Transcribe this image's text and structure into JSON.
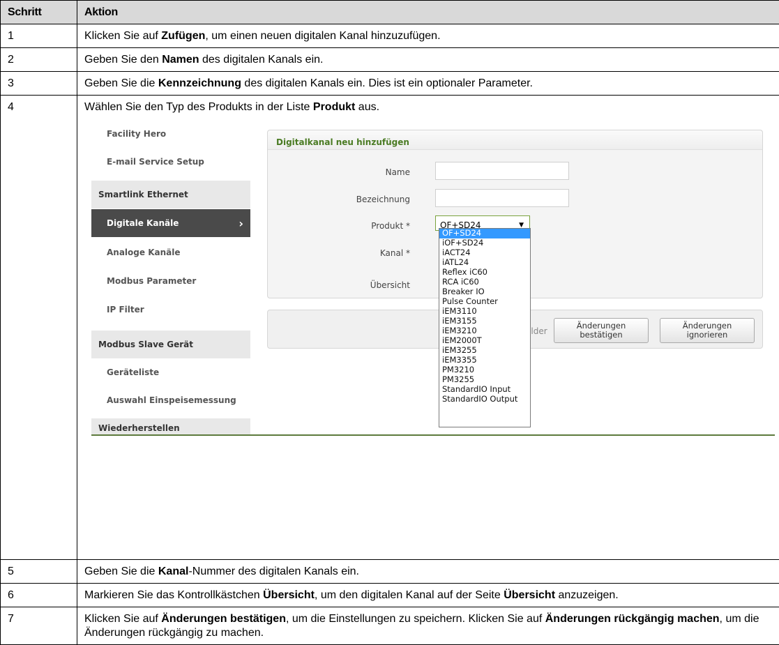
{
  "header": {
    "col_step": "Schritt",
    "col_action": "Aktion"
  },
  "rows": [
    {
      "step": "1",
      "parts": [
        "Klicken Sie auf ",
        "Zufügen",
        ", um einen neuen digitalen Kanal hinzuzufügen."
      ]
    },
    {
      "step": "2",
      "parts": [
        "Geben Sie den ",
        "Namen",
        " des digitalen Kanals ein."
      ]
    },
    {
      "step": "3",
      "parts": [
        "Geben Sie die ",
        "Kennzeichnung",
        " des digitalen Kanals ein. Dies ist ein optionaler Parameter."
      ]
    },
    {
      "step": "4",
      "parts": [
        "Wählen Sie den Typ des Produkts in der Liste ",
        "Produkt",
        " aus."
      ]
    },
    {
      "step": "5",
      "parts": [
        "Geben Sie die ",
        "Kanal",
        "-Nummer des digitalen Kanals ein."
      ]
    },
    {
      "step": "6",
      "parts": [
        "Markieren Sie das Kontrollkästchen ",
        "Übersicht",
        ", um den digitalen Kanal auf der Seite ",
        "Übersicht",
        " anzuzeigen."
      ]
    },
    {
      "step": "7",
      "parts": [
        "Klicken Sie auf ",
        "Änderungen bestätigen",
        ", um die Einstellungen zu speichern. Klicken Sie auf ",
        "Änderungen rückgängig machen",
        ", um die Änderungen rückgängig zu machen."
      ]
    }
  ],
  "screenshot": {
    "sidebar": [
      {
        "label": "Facility Hero",
        "kind": "sub"
      },
      {
        "label": "E-mail Service Setup",
        "kind": "sub"
      },
      {
        "label": "Smartlink Ethernet",
        "kind": "section"
      },
      {
        "label": "Digitale Kanäle",
        "kind": "active"
      },
      {
        "label": "Analoge Kanäle",
        "kind": "sub"
      },
      {
        "label": "Modbus Parameter",
        "kind": "sub"
      },
      {
        "label": "IP Filter",
        "kind": "sub"
      },
      {
        "label": "Modbus Slave Gerät",
        "kind": "section"
      },
      {
        "label": "Geräteliste",
        "kind": "sub"
      },
      {
        "label": "Auswahl Einspeisemessung",
        "kind": "sub"
      },
      {
        "label": "Wiederherstellen",
        "kind": "section"
      }
    ],
    "panel_title": "Digitalkanal neu hinzufügen",
    "form": {
      "name_label": "Name",
      "bezeichnung_label": "Bezeichnung",
      "produkt_label": "Produkt *",
      "produkt_value": "OF+SD24",
      "kanal_label": "Kanal *",
      "uebersicht_label": "Übersicht"
    },
    "dropdown_options": [
      "OF+SD24",
      "iOF+SD24",
      "iACT24",
      "iATL24",
      "Reflex iC60",
      "RCA iC60",
      "Breaker IO",
      "Pulse Counter",
      "iEM3110",
      "iEM3155",
      "iEM3210",
      "iEM2000T",
      "iEM3255",
      "iEM3355",
      "PM3210",
      "PM3255",
      "StandardIO Input",
      "StandardIO Output"
    ],
    "dropdown_selected": "OF+SD24",
    "required_note_fragment": "elder",
    "confirm_button": [
      "Änderungen",
      "bestätigen"
    ],
    "ignore_button": [
      "Änderungen",
      "ignorieren"
    ]
  }
}
